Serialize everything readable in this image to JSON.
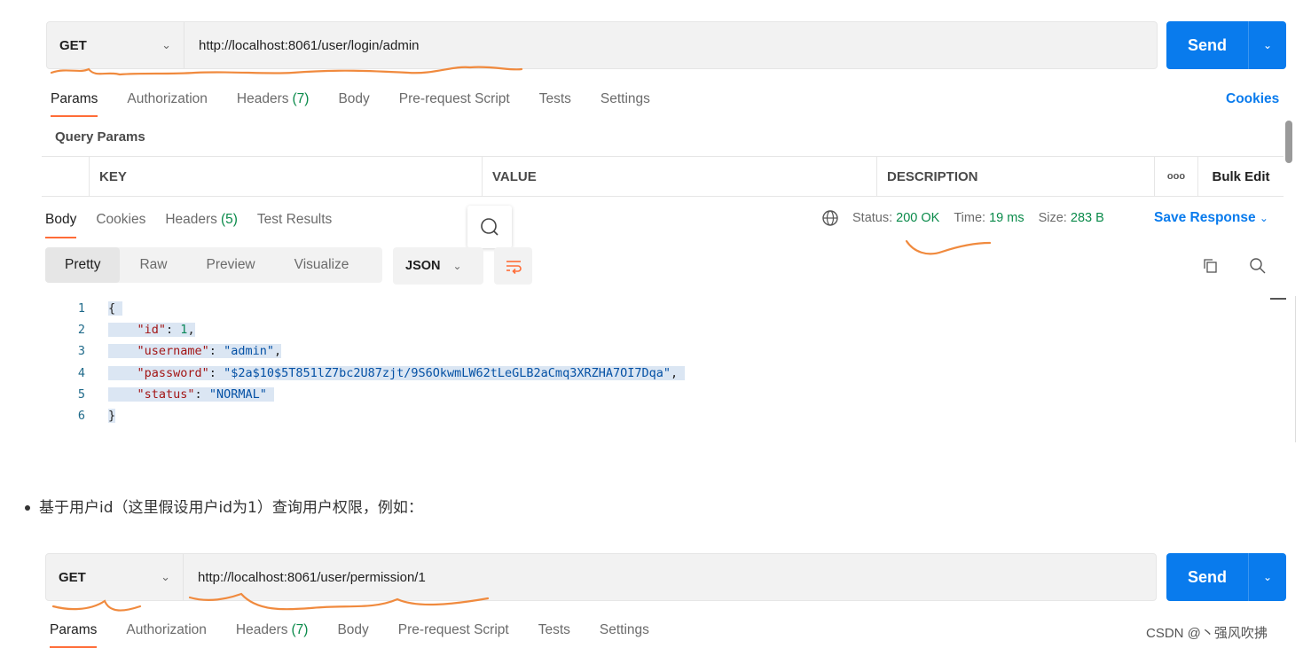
{
  "request1": {
    "method": "GET",
    "url": "http://localhost:8061/user/login/admin",
    "send_label": "Send"
  },
  "tabs": {
    "params": "Params",
    "authorization": "Authorization",
    "headers": "Headers",
    "headers_count": "(7)",
    "body": "Body",
    "prerequest": "Pre-request Script",
    "tests": "Tests",
    "settings": "Settings"
  },
  "cookies_link": "Cookies",
  "query_params_title": "Query Params",
  "params_table": {
    "key": "KEY",
    "value": "VALUE",
    "description": "DESCRIPTION",
    "more": "ooo",
    "bulk_edit": "Bulk Edit"
  },
  "response_tabs": {
    "body": "Body",
    "cookies": "Cookies",
    "headers": "Headers",
    "headers_count": "(5)",
    "test_results": "Test Results"
  },
  "response_status": {
    "status_label": "Status:",
    "status_value": "200 OK",
    "time_label": "Time:",
    "time_value": "19 ms",
    "size_label": "Size:",
    "size_value": "283 B"
  },
  "save_response": "Save Response",
  "view_modes": {
    "pretty": "Pretty",
    "raw": "Raw",
    "preview": "Preview",
    "visualize": "Visualize"
  },
  "format": "JSON",
  "code_lines": [
    {
      "num": "1"
    },
    {
      "num": "2",
      "key": "\"id\"",
      "value": "1"
    },
    {
      "num": "3",
      "key": "\"username\"",
      "value": "\"admin\""
    },
    {
      "num": "4",
      "key": "\"password\"",
      "value": "\"$2a$10$5T851lZ7bc2U87zjt/9S6OkwmLW62tLeGLB2aCmq3XRZHA7OI7Dqa\""
    },
    {
      "num": "5",
      "key": "\"status\"",
      "value": "\"NORMAL\""
    },
    {
      "num": "6"
    }
  ],
  "bullet_text": "基于用户id（这里假设用户id为1）查询用户权限，例如：",
  "request2": {
    "method": "GET",
    "url": "http://localhost:8061/user/permission/1",
    "send_label": "Send"
  },
  "watermark": "CSDN @丶强风吹拂",
  "colors": {
    "send_blue": "#097bed",
    "active_tab_orange": "#ff6c37",
    "status_green": "#0a8a4a",
    "annotation_orange": "#f08a3e"
  }
}
